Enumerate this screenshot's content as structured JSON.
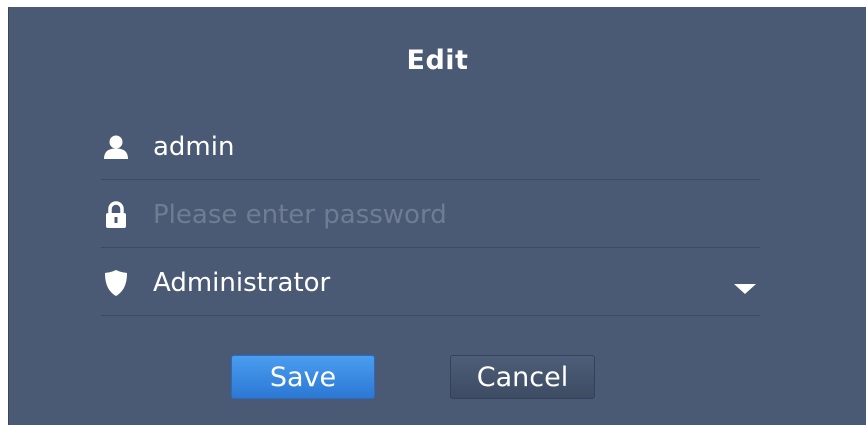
{
  "dialog": {
    "title": "Edit",
    "username": {
      "value": "admin",
      "icon": "user-icon"
    },
    "password": {
      "value": "",
      "placeholder": "Please enter password",
      "icon": "lock-icon"
    },
    "role": {
      "selected": "Administrator",
      "icon": "shield-icon"
    },
    "buttons": {
      "save_label": "Save",
      "cancel_label": "Cancel"
    }
  },
  "colors": {
    "background": "#4a5a74",
    "primary": "#3a8be6",
    "text": "#ffffff",
    "placeholder": "#6f7d93"
  }
}
